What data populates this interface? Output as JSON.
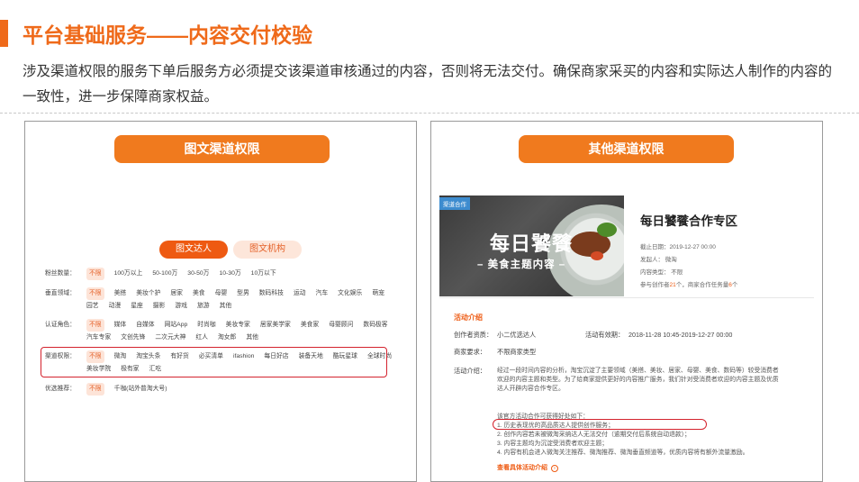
{
  "header": {
    "title": "平台基础服务——内容交付校验",
    "description": "涉及渠道权限的服务下单后服务方必须提交该渠道审核通过的内容，否则将无法交付。确保商家采买的内容和实际达人制作的内容的一致性，进一步保障商家权益。",
    "accent_color": "#ef6a1a"
  },
  "left_panel": {
    "tag": "图文渠道权限",
    "segments": [
      "图文达人",
      "图文机构"
    ],
    "filters": [
      {
        "label": "粉丝数量：",
        "options": [
          "不限",
          "100万以上",
          "50-100万",
          "30-50万",
          "10-30万",
          "10万以下"
        ]
      },
      {
        "label": "垂直领域：",
        "options": [
          "不限",
          "美搭",
          "美妆个护",
          "居家",
          "美食",
          "母婴",
          "型男",
          "数码科技",
          "运动",
          "汽车",
          "文化娱乐",
          "萌宠",
          "园艺",
          "动漫",
          "星座",
          "摄影",
          "游戏",
          "旅游",
          "其他"
        ]
      },
      {
        "label": "认证角色：",
        "options": [
          "不限",
          "媒体",
          "自媒体",
          "网站App",
          "时尚咖",
          "美妆专家",
          "居家美学家",
          "美食家",
          "母婴顾问",
          "数码极客",
          "汽车专家",
          "文创先锋",
          "二次元大神",
          "红人",
          "淘女郎",
          "其他"
        ]
      },
      {
        "label": "渠道权限：",
        "options": [
          "不限",
          "微淘",
          "淘宝头条",
          "有好货",
          "必买清单",
          "ifashion",
          "每日好店",
          "装备天地",
          "酷玩星球",
          "全球时尚",
          "美妆学院",
          "极有家",
          "汇吃"
        ]
      },
      {
        "label": "优选推荐：",
        "options": [
          "不限",
          "千咖(站外普淘大号)"
        ]
      }
    ]
  },
  "right_panel": {
    "tag": "其他渠道权限",
    "card": {
      "badge": "渠道合作",
      "banner_title": "每日饕餮",
      "banner_subtitle": "– 美食主题内容 –",
      "zone_title": "每日饕餮合作专区",
      "deadline": "截止日期：2019-12-27 00:00",
      "platform": "发起人：  微淘",
      "content_type": "内容类型：  不限",
      "participants_prefix": "参与创作者",
      "participants_count": "21",
      "participants_mid": "个，商家合作任务量",
      "tasks_count": "6",
      "participants_suffix": "个"
    },
    "activity": {
      "heading": "活动介绍",
      "creator_label": "创作者资质：",
      "creator_value": "小二优选达人",
      "valid_label": "活动有效期：",
      "valid_value": "2018-11-28 10:45-2019-12-27 00:00",
      "merchant_label": "商家要求：",
      "merchant_value": "不限商家类型",
      "intro_label": "活动介绍：",
      "intro_text": "经过一段时间内容的分析，淘宝沉淀了主要领域（美搭、美妆、居家、母婴、美食、数码等）较受消费者欢迎的内容主题和类型。为了给商家提供更好的内容推广服务，我们针对受消费者欢迎的内容主题及优质达人开辟内容合作专区。",
      "benefits_title": "该官方活动合作可获得好处如下：",
      "benefits": [
        "1. 历史表现优的高品质达人提供创作服务；",
        "2. 创作内容若未被微淘采纳达人无法交付（逾期交付后系统自动退款）；",
        "3. 内容主题均为沉淀受消费者欢迎主题；",
        "4. 内容有机会进入微淘关注推荐、微淘推荐、微淘垂直频道等，优质内容将有额外流量激励。"
      ],
      "view_link": "查看具体活动介绍"
    }
  }
}
